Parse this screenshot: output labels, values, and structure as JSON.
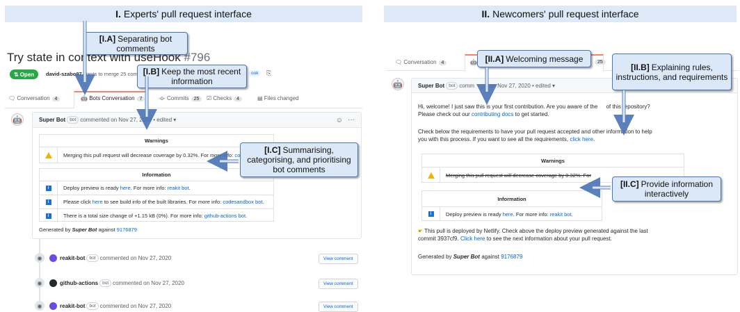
{
  "left": {
    "header_num": "I.",
    "header_text": "Experts' pull request interface",
    "title": "Try state in context with useHook",
    "title_num": "#796",
    "badge": "Open",
    "merge_user": "david-szabo97",
    "merge_text": "wants to merge 25 commits into",
    "merge_branch": "ook",
    "tabs": [
      {
        "label": "Conversation",
        "count": "4"
      },
      {
        "label": "Bots Conversation",
        "count": "7"
      },
      {
        "label": "Commits",
        "count": "25"
      },
      {
        "label": "Checks",
        "count": "4"
      },
      {
        "label": "Files changed",
        "count": ""
      }
    ],
    "comment_author": "Super Bot",
    "bot_label": "bot",
    "comment_meta": "commented on Nov 27, 2020 • edited ▾",
    "warnings_title": "Warnings",
    "warning_text": "Merging this pull request will decrease coverage by 0.32%. For more info:",
    "warning_link": "co",
    "information_title": "Information",
    "info_rows": [
      {
        "text": "Deploy preview is ready",
        "link1": "here",
        "mid": ". For more info:",
        "link2": "reakit bot",
        "end": "."
      },
      {
        "text": "Please click",
        "link1": "here",
        "mid": "to see build info of the built libraries. For more info:",
        "link2": "codesandbox bot",
        "end": "."
      },
      {
        "text": "There is a total size change of +1.15 kB (0%). For more info:",
        "link1": "",
        "mid": "",
        "link2": "github-actions bot",
        "end": "."
      }
    ],
    "generated_prefix": "Generated by",
    "generated_bot": "Super Bot",
    "generated_mid": "against",
    "generated_sha": "9176879",
    "events": [
      {
        "author": "reakit-bot",
        "meta": "commented on Nov 27, 2020",
        "button": "View comment"
      },
      {
        "author": "github-actions",
        "meta": "commented on Nov 27, 2020",
        "button": "View comment"
      },
      {
        "author": "reakit-bot",
        "meta": "commented on Nov 27, 2020",
        "button": "View comment"
      }
    ],
    "callouts": {
      "ia_tag": "[I.A]",
      "ia_text": "Separating bot comments",
      "ib_tag": "[I.B]",
      "ib_text": "Keep the most recent information",
      "ic_tag": "[I.C]",
      "ic_text": "Summarising, categorising, and prioritising bot comments"
    }
  },
  "right": {
    "header_num": "II.",
    "header_text": "Newcomers' pull request interface",
    "tab_conversation": "Conversation",
    "tab_conversation_count": "4",
    "tab_commits_count": "25",
    "comment_author": "Super Bot",
    "bot_label": "bot",
    "comment_meta_left": "comm",
    "comment_meta_right": "on Nov 27, 2020 • edited ▾",
    "welcome_1": "Hi, welcome! I just saw this is your first contribution. Are you aware of the",
    "welcome_1b": "of this repository?",
    "welcome_2a": "Please check out our",
    "welcome_2_link": "contributing docs",
    "welcome_2b": "to get started.",
    "check_1": "Check below the requirements to have your pull request accepted and other information to help",
    "check_2a": "you with this process. If you want to see all the requirements,",
    "check_2_link": "click here",
    "warnings_title": "Warnings",
    "warning_text": "Merging this pull request will decrease coverage by 0.32%. For",
    "information_title": "Information",
    "deploy_a": "Deploy preview is ready",
    "deploy_link1": "here",
    "deploy_mid": ". For more info:",
    "deploy_link2": "reakit bot",
    "netlify_1": "This pull is deployed by Netlify. Check above the deploy preview generated against the last",
    "netlify_2a": "commit 3937cf9.",
    "netlify_link": "Click here",
    "netlify_2b": "to see the next information about your pull request.",
    "generated_prefix": "Generated by",
    "generated_bot": "Super Bot",
    "generated_mid": "against",
    "generated_sha": "9176879",
    "callouts": {
      "iia_tag": "[II.A]",
      "iia_text": "Welcoming message",
      "iib_tag": "[II.B]",
      "iib_text": "Explaining rules, instructions, and requirements",
      "iic_tag": "[II.C]",
      "iic_text": "Provide information interactively"
    }
  },
  "colors": {
    "header_bg": "#dde9f7",
    "callout_bg": "#dbe8f8",
    "callout_border": "#4a74b5",
    "open_green": "#28a745",
    "link": "#0366d6"
  },
  "icons": [
    "robot-icon",
    "speech-bubble-icon",
    "commit-icon",
    "checks-icon",
    "file-icon",
    "eye-icon",
    "warning-icon",
    "info-icon",
    "pointing-hand-icon",
    "smiley-icon",
    "ellipsis-icon",
    "copy-icon",
    "pull-request-icon"
  ]
}
